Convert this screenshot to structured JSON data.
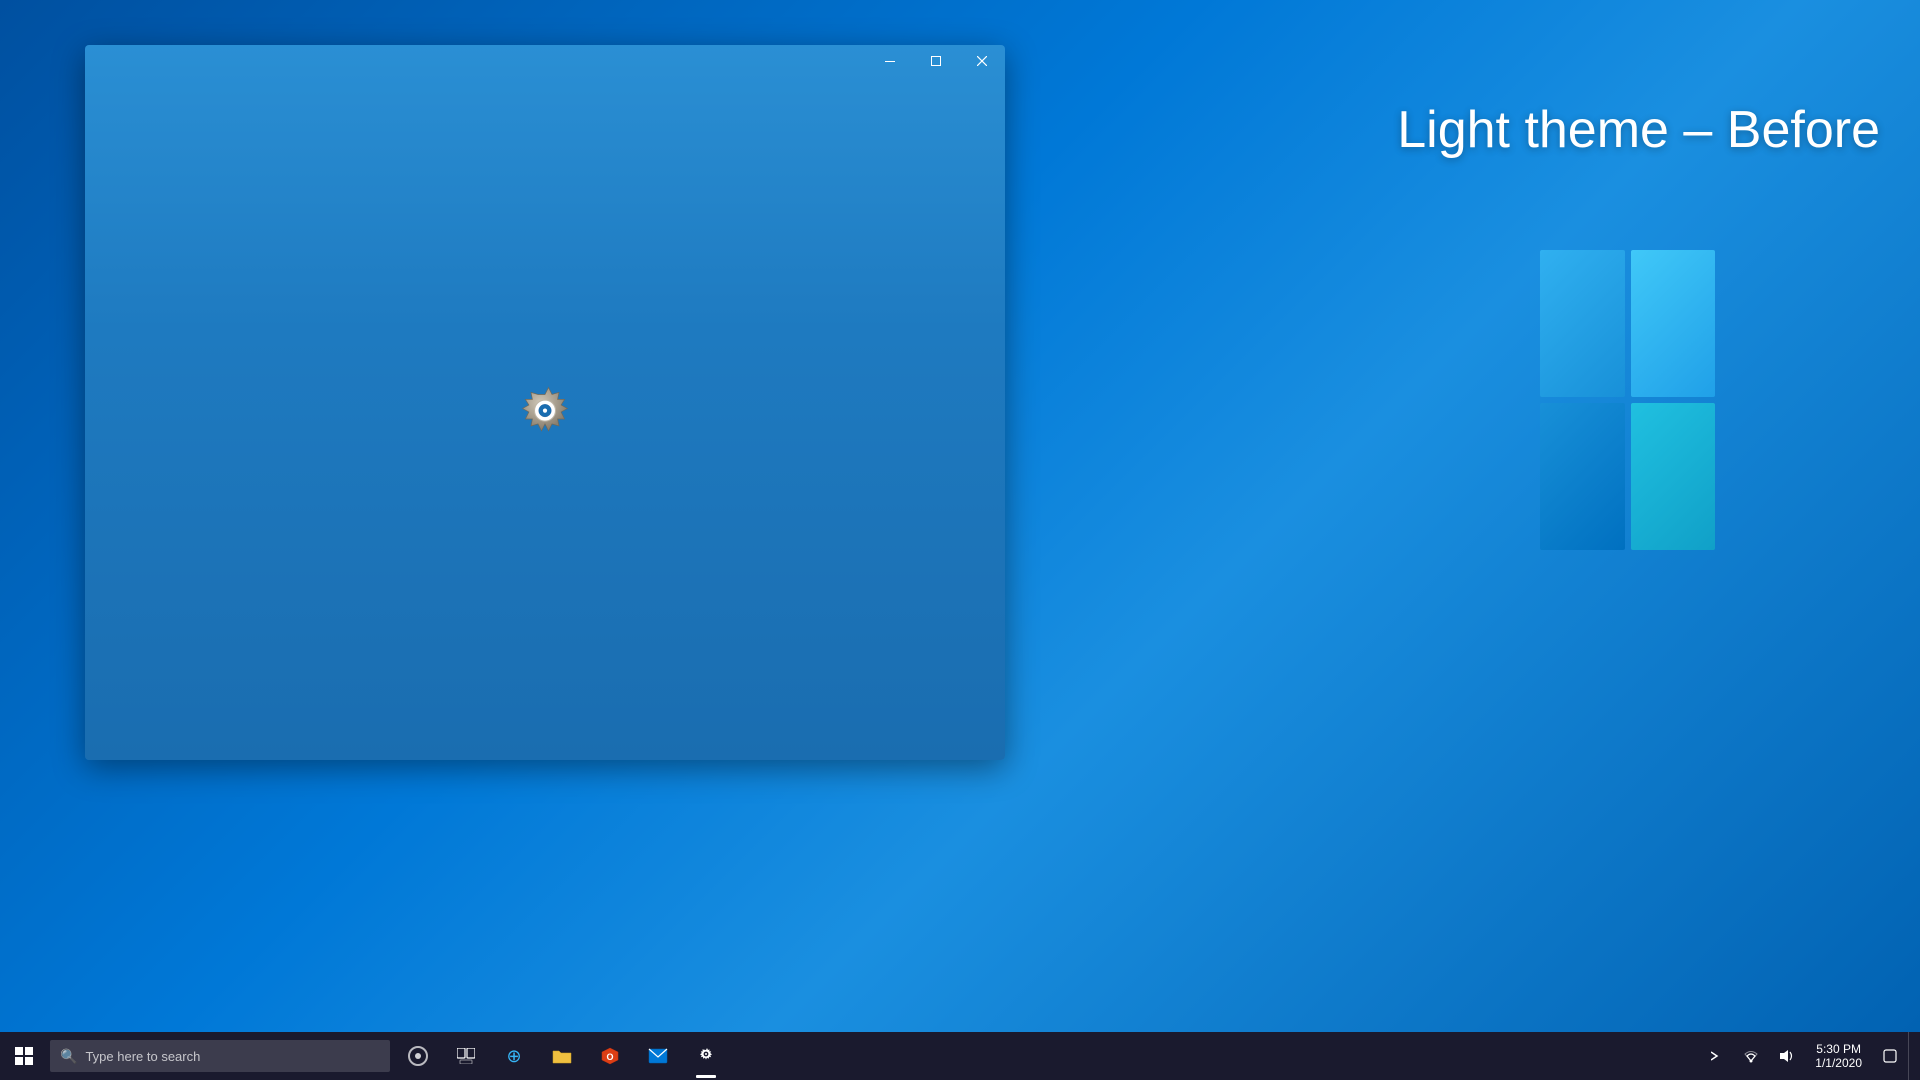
{
  "desktop": {
    "background_color": "#0078d7"
  },
  "theme_label": {
    "text": "Light theme – Before"
  },
  "settings_window": {
    "title": "Settings",
    "loading": true,
    "titlebar": {
      "minimize_label": "minimize",
      "maximize_label": "maximize",
      "close_label": "close"
    }
  },
  "taskbar": {
    "search_placeholder": "Type here to search",
    "icons": [
      {
        "name": "cortana",
        "label": "Cortana"
      },
      {
        "name": "task-view",
        "label": "Task View"
      },
      {
        "name": "edge",
        "label": "Microsoft Edge"
      },
      {
        "name": "explorer",
        "label": "File Explorer"
      },
      {
        "name": "office",
        "label": "Office"
      },
      {
        "name": "mail",
        "label": "Mail"
      },
      {
        "name": "settings",
        "label": "Settings",
        "active": true
      }
    ],
    "system_tray": {
      "icons": [
        "chevron",
        "network",
        "volume",
        "battery-or-locale"
      ],
      "time": "5:30 PM",
      "date": "1/1/2020"
    }
  }
}
